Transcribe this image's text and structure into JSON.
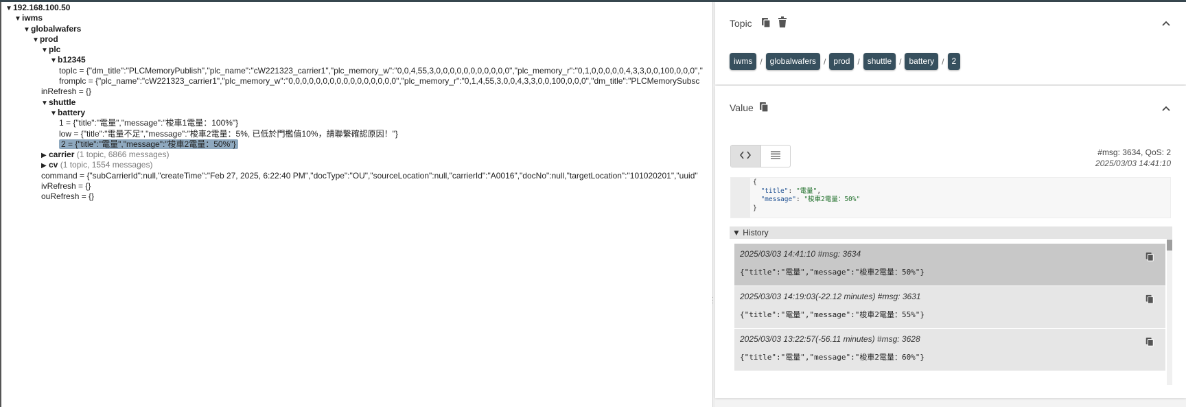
{
  "tree": {
    "nodes": [
      {
        "indent": 0,
        "toggle": "▼",
        "name": "192.168.100.50",
        "value": "",
        "meta": ""
      },
      {
        "indent": 1,
        "toggle": "▼",
        "name": "iwms",
        "value": "",
        "meta": ""
      },
      {
        "indent": 2,
        "toggle": "▼",
        "name": "globalwafers",
        "value": "",
        "meta": ""
      },
      {
        "indent": 3,
        "toggle": "▼",
        "name": "prod",
        "value": "",
        "meta": ""
      },
      {
        "indent": 4,
        "toggle": "▼",
        "name": "plc",
        "value": "",
        "meta": ""
      },
      {
        "indent": 5,
        "toggle": "▼",
        "name": "b12345",
        "value": "",
        "meta": ""
      },
      {
        "indent": 6,
        "toggle": "",
        "name": "",
        "value": "topIc = {\"dm_title\":\"PLCMemoryPublish\",\"plc_name\":\"cW221323_carrier1\",\"plc_memory_w\":\"0,0,4,55,3,0,0,0,0,0,0,0,0,0,0,0\",\"plc_memory_r\":\"0,1,0,0,0,0,0,4,3,3,0,0,100,0,0,0\",\"",
        "meta": ""
      },
      {
        "indent": 6,
        "toggle": "",
        "name": "",
        "value": "fromplc = {\"plc_name\":\"cW221323_carrier1\",\"plc_memory_w\":\"0,0,0,0,0,0,0,0,0,0,0,0,0,0,0,0\",\"plc_memory_r\":\"0,1,4,55,3,0,0,4,3,3,0,0,100,0,0,0\",\"dm_title\":\"PLCMemorySubsc",
        "meta": ""
      },
      {
        "indent": 4,
        "toggle": "",
        "name": "",
        "value": "inRefresh = {}",
        "meta": ""
      },
      {
        "indent": 4,
        "toggle": "▼",
        "name": "shuttle",
        "value": "",
        "meta": ""
      },
      {
        "indent": 5,
        "toggle": "▼",
        "name": "battery",
        "value": "",
        "meta": ""
      },
      {
        "indent": 6,
        "toggle": "",
        "name": "",
        "value": "1 = {\"title\":\"電量\",\"message\":\"梭車1電量：100%\"}",
        "meta": ""
      },
      {
        "indent": 6,
        "toggle": "",
        "name": "",
        "value": "low = {\"title\":\"電量不足\",\"message\":\"梭車2電量：5%, 已低於門檻值10%，請聯繫確認原因！\"}",
        "meta": ""
      },
      {
        "indent": 6,
        "toggle": "",
        "name": "",
        "value": "2 = {\"title\":\"電量\",\"message\":\"梭車2電量：50%\"}",
        "meta": "",
        "selected": true
      },
      {
        "indent": 4,
        "toggle": "▶",
        "name": "carrier",
        "value": "",
        "meta": "(1 topic, 6866 messages)"
      },
      {
        "indent": 4,
        "toggle": "▶",
        "name": "cv",
        "value": "",
        "meta": "(1 topic, 1554 messages)"
      },
      {
        "indent": 4,
        "toggle": "",
        "name": "",
        "value": "command = {\"subCarrierId\":null,\"createTime\":\"Feb 27, 2025, 6:22:40 PM\",\"docType\":\"OU\",\"sourceLocation\":null,\"carrierId\":\"A0016\",\"docNo\":null,\"targetLocation\":\"101020201\",\"uuid\"",
        "meta": ""
      },
      {
        "indent": 4,
        "toggle": "",
        "name": "",
        "value": "ivRefresh = {}",
        "meta": ""
      },
      {
        "indent": 4,
        "toggle": "",
        "name": "",
        "value": "ouRefresh = {}",
        "meta": ""
      }
    ]
  },
  "topic": {
    "title": "Topic",
    "copy_icon": "copy-icon",
    "delete_icon": "trash-icon",
    "crumbs": [
      "iwms",
      "globalwafers",
      "prod",
      "shuttle",
      "battery",
      "2"
    ],
    "separator": "/"
  },
  "value": {
    "title": "Value",
    "msg_info": "#msg: 3634, QoS: 2",
    "timestamp": "2025/03/03 14:41:10",
    "json_lines": {
      "open": "{",
      "title_key": "\"title\"",
      "title_val": "\"電量\"",
      "message_key": "\"message\"",
      "message_val": "\"梭車2電量：50%\"",
      "close": "}"
    }
  },
  "history": {
    "title": "History",
    "items": [
      {
        "ts": "2025/03/03 14:41:10 #msg: 3634",
        "value": "{\"title\":\"電量\",\"message\":\"梭車2電量：50%\"}",
        "selected": true
      },
      {
        "ts": "2025/03/03 14:19:03(-22.12 minutes) #msg: 3631",
        "value": "{\"title\":\"電量\",\"message\":\"梭車2電量：55%\"}",
        "selected": false
      },
      {
        "ts": "2025/03/03 13:22:57(-56.11 minutes) #msg: 3628",
        "value": "{\"title\":\"電量\",\"message\":\"梭車2電量：60%\"}",
        "selected": false
      }
    ]
  },
  "colors": {
    "chip": "#37505e",
    "selected_tree": "#8fa9bf",
    "accent_bar": "#37474f"
  }
}
